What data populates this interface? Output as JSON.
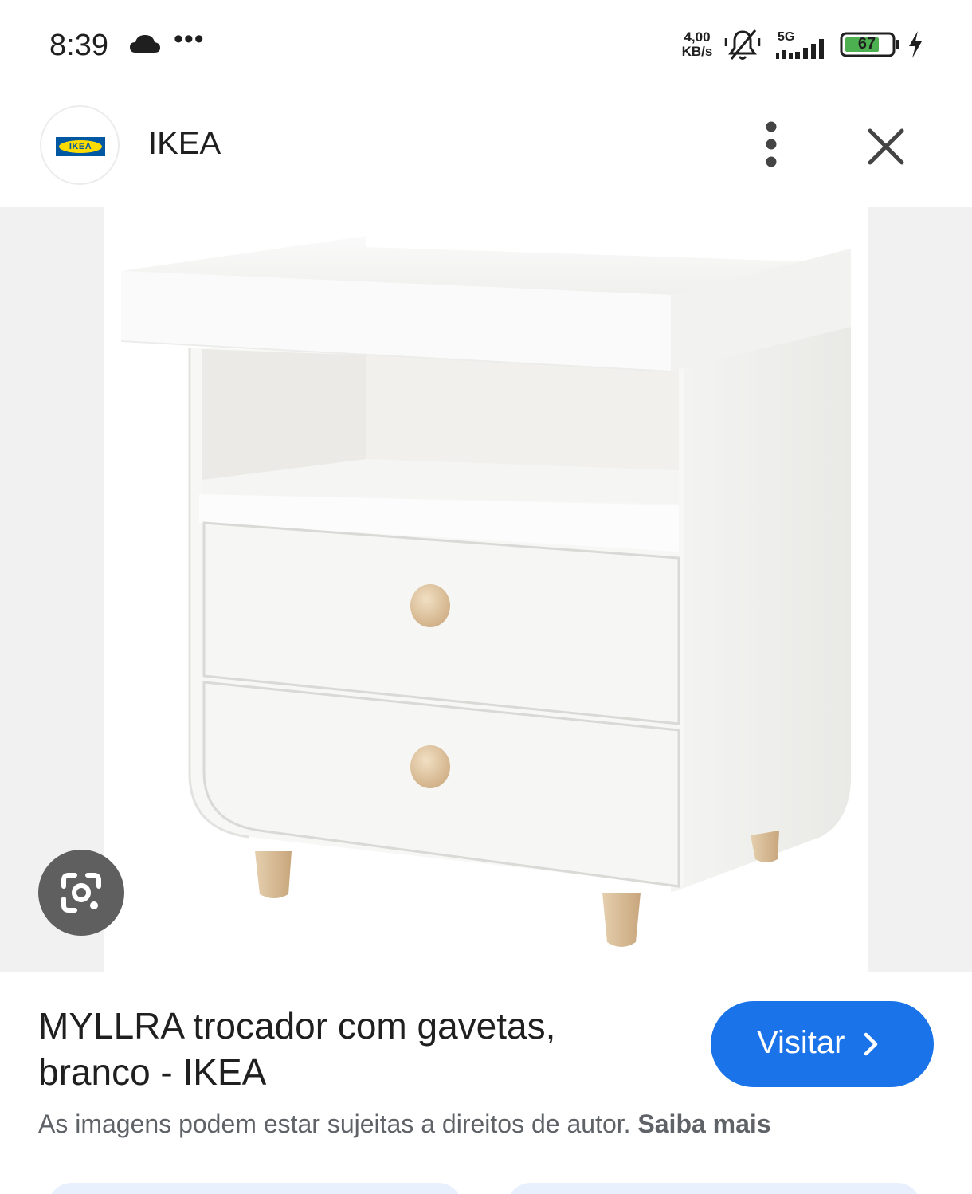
{
  "status_bar": {
    "time": "8:39",
    "more_notifications": "•••",
    "net_speed_value": "4,00",
    "net_speed_unit": "KB/s",
    "network_type": "5G",
    "battery_level": "67",
    "icons": [
      "cloud-icon",
      "mute-icon",
      "signal-icon",
      "battery-icon",
      "charging-icon"
    ]
  },
  "header": {
    "logo_text": "IKEA",
    "site_name": "IKEA",
    "more_icon": "more-vert-icon",
    "close_icon": "close-icon"
  },
  "image": {
    "lens_icon": "google-lens-icon"
  },
  "result": {
    "title_line1": "MYLLRA trocador com gavetas,",
    "title_line2": "branco - IKEA",
    "visit_label": "Visitar",
    "copyright_text": "As imagens podem estar sujeitas a direitos de autor.",
    "learn_more": "Saiba mais"
  },
  "colors": {
    "accent": "#1a73e8",
    "ikea_blue": "#0058a3",
    "ikea_yellow": "#ffdb00",
    "battery_green": "#4caf50"
  }
}
